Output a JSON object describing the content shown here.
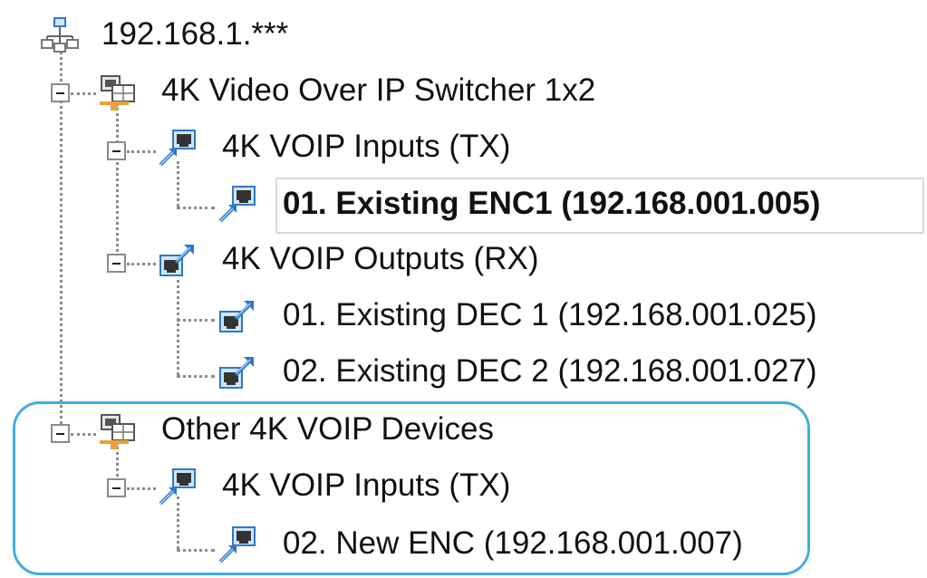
{
  "tree": {
    "root": {
      "label": "192.168.1.***",
      "icon": "network-icon"
    },
    "nodes": [
      {
        "label": "4K Video Over IP Switcher 1x2",
        "icon": "switcher-device-icon",
        "expanded": true
      },
      {
        "label": "4K VOIP Inputs (TX)",
        "icon": "encoder-group-icon",
        "expanded": true
      },
      {
        "label": "01. Existing ENC1 (192.168.001.005)",
        "icon": "encoder-icon",
        "selected": true
      },
      {
        "label": "4K VOIP Outputs (RX)",
        "icon": "decoder-group-icon",
        "expanded": true
      },
      {
        "label": "01. Existing DEC 1 (192.168.001.025)",
        "icon": "decoder-icon"
      },
      {
        "label": "02. Existing DEC 2 (192.168.001.027)",
        "icon": "decoder-icon"
      },
      {
        "label": "Other 4K VOIP Devices",
        "icon": "switcher-device-icon",
        "expanded": true
      },
      {
        "label": "4K VOIP Inputs (TX)",
        "icon": "encoder-group-icon",
        "expanded": true
      },
      {
        "label": "02. New ENC (192.168.001.007)",
        "icon": "encoder-icon"
      }
    ]
  },
  "colors": {
    "highlight": "#3eaee0",
    "icon_blue": "#2f78c8",
    "icon_light": "#a7d3f3",
    "connector": "#8c8c8c"
  }
}
